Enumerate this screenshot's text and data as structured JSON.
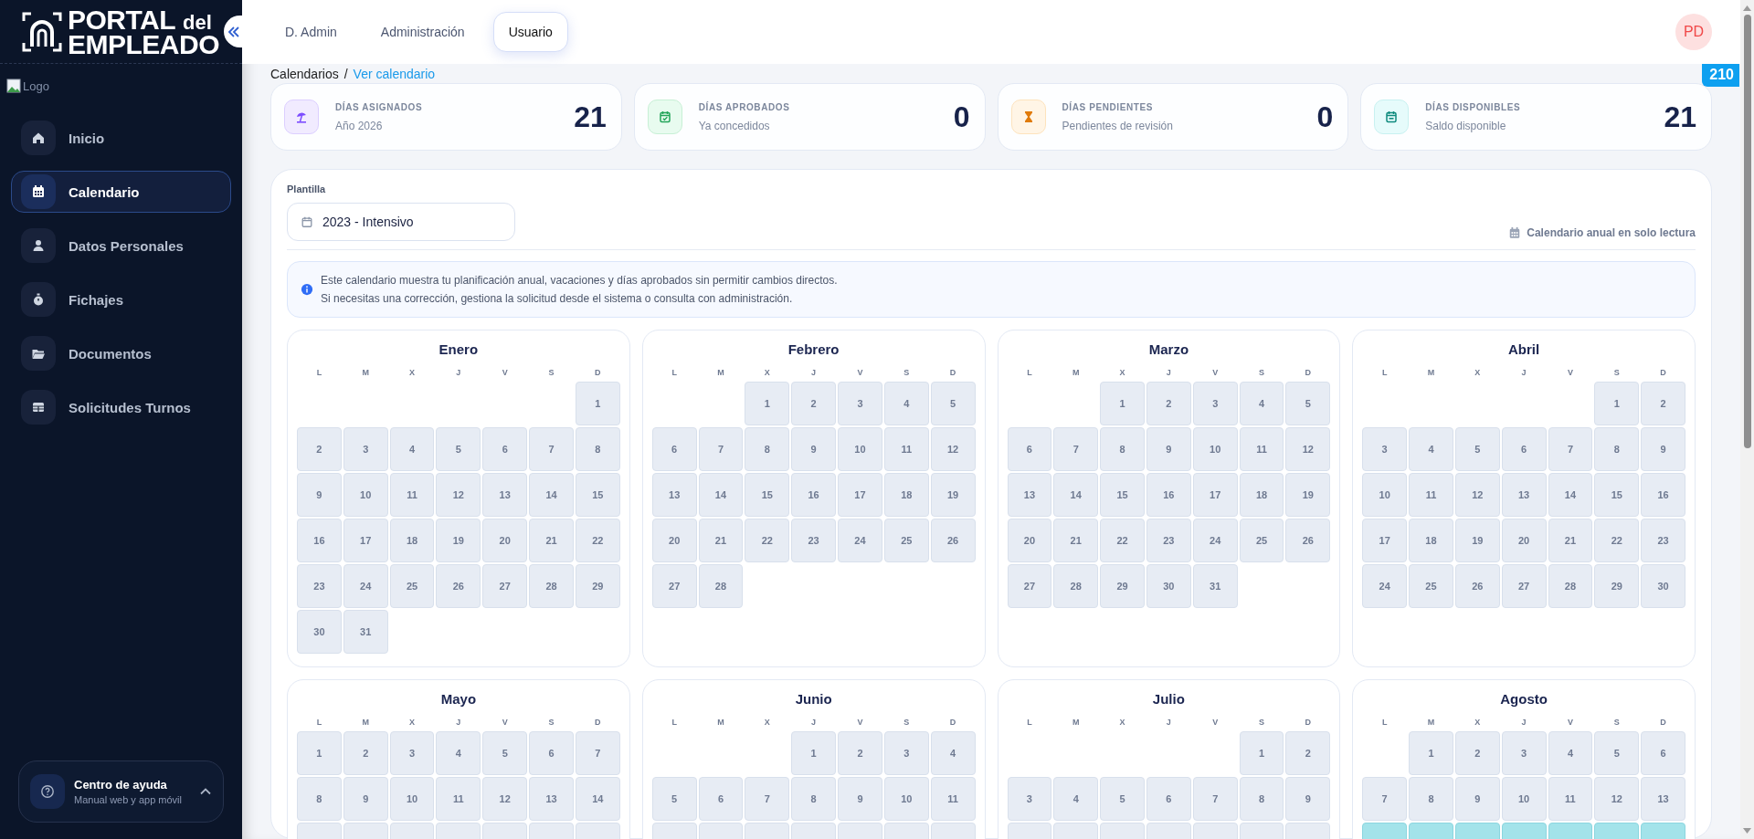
{
  "sidebar": {
    "logo": {
      "line1": "PORTAL",
      "line1_small": "del",
      "line2": "EMPLEADO"
    },
    "broken_image": {
      "alt": "Logo"
    },
    "items": [
      {
        "label": "Inicio",
        "kind": "home",
        "selected": false
      },
      {
        "label": "Calendario",
        "kind": "calendar",
        "selected": true
      },
      {
        "label": "Datos Personales",
        "kind": "user",
        "selected": false
      },
      {
        "label": "Fichajes",
        "kind": "stopwatch",
        "selected": false
      },
      {
        "label": "Documentos",
        "kind": "folder",
        "selected": false
      },
      {
        "label": "Solicitudes Turnos",
        "kind": "table",
        "selected": false
      }
    ],
    "help": {
      "title": "Centro de ayuda",
      "subtitle": "Manual web y app móvil"
    }
  },
  "topbar": {
    "tabs": [
      {
        "label": "D. Admin",
        "selected": false
      },
      {
        "label": "Administración",
        "selected": false
      },
      {
        "label": "Usuario",
        "selected": true
      }
    ],
    "avatar": "PD"
  },
  "badge": "210",
  "breadcrumb": {
    "parent": "Calendarios",
    "separator": "/",
    "current": "Ver calendario"
  },
  "stats": [
    {
      "kind": "assigned",
      "title": "DÍAS ASIGNADOS",
      "subtitle": "Año 2026",
      "value": "21"
    },
    {
      "kind": "approved",
      "title": "DÍAS APROBADOS",
      "subtitle": "Ya concedidos",
      "value": "0"
    },
    {
      "kind": "pending",
      "title": "DÍAS PENDIENTES",
      "subtitle": "Pendientes de revisión",
      "value": "0"
    },
    {
      "kind": "available",
      "title": "DÍAS DISPONIBLES",
      "subtitle": "Saldo disponible",
      "value": "21"
    }
  ],
  "panel": {
    "template_label": "Plantilla",
    "template_value": "2023 - Intensivo",
    "readonly_note": "Calendario anual en solo lectura",
    "info": [
      "Este calendario muestra tu planificación anual, vacaciones y días aprobados sin permitir cambios directos.",
      "Si necesitas una corrección, gestiona la solicitud desde el sistema o consulta con administración."
    ]
  },
  "months": [
    {
      "name": "Enero",
      "weekdays": [
        "L",
        "M",
        "X",
        "J",
        "V",
        "S",
        "D"
      ],
      "lead": [
        {
          "kind": "blank"
        },
        {
          "kind": "blank"
        },
        {
          "kind": "blank"
        },
        {
          "kind": "blank"
        },
        {
          "kind": "blank"
        },
        {
          "kind": "blank"
        }
      ],
      "days": [
        "1",
        "2",
        "3",
        "4",
        "5",
        "6",
        "7",
        "8",
        "9",
        "10",
        "11",
        "12",
        "13",
        "14",
        "15",
        "16",
        "17",
        "18",
        "19",
        "20",
        "21",
        "22",
        "23",
        "24",
        "25",
        "26",
        "27",
        "28",
        "29",
        "30",
        "31"
      ]
    },
    {
      "name": "Febrero",
      "weekdays": [
        "L",
        "M",
        "X",
        "J",
        "V",
        "S",
        "D"
      ],
      "lead": [
        {
          "kind": "blank"
        },
        {
          "kind": "blank"
        }
      ],
      "days": [
        "1",
        "2",
        "3",
        "4",
        "5",
        "6",
        "7",
        "8",
        "9",
        "10",
        "11",
        "12",
        "13",
        "14",
        "15",
        "16",
        "17",
        "18",
        "19",
        "20",
        "21",
        "22",
        "23",
        "24",
        "25",
        "26",
        "27",
        "28"
      ]
    },
    {
      "name": "Marzo",
      "weekdays": [
        "L",
        "M",
        "X",
        "J",
        "V",
        "S",
        "D"
      ],
      "lead": [
        {
          "kind": "blank"
        },
        {
          "kind": "blank"
        }
      ],
      "days": [
        "1",
        "2",
        "3",
        "4",
        "5",
        "6",
        "7",
        "8",
        "9",
        "10",
        "11",
        "12",
        "13",
        "14",
        "15",
        "16",
        "17",
        "18",
        "19",
        "20",
        "21",
        "22",
        "23",
        "24",
        "25",
        "26",
        "27",
        "28",
        "29",
        "30",
        "31"
      ]
    },
    {
      "name": "Abril",
      "weekdays": [
        "L",
        "M",
        "X",
        "J",
        "V",
        "S",
        "D"
      ],
      "lead": [
        {
          "kind": "blank"
        },
        {
          "kind": "blank"
        },
        {
          "kind": "blank"
        },
        {
          "kind": "blank"
        },
        {
          "kind": "blank"
        }
      ],
      "days": [
        "1",
        "2",
        "3",
        "4",
        "5",
        "6",
        "7",
        "8",
        "9",
        "10",
        "11",
        "12",
        "13",
        "14",
        "15",
        "16",
        "17",
        "18",
        "19",
        "20",
        "21",
        "22",
        "23",
        "24",
        "25",
        "26",
        "27",
        "28",
        "29",
        "30"
      ]
    },
    {
      "name": "Mayo",
      "weekdays": [
        "L",
        "M",
        "X",
        "J",
        "V",
        "S",
        "D"
      ],
      "days": [
        "1",
        "2",
        "3",
        "4",
        "5",
        "6",
        "7",
        "8",
        "9",
        "10",
        "11",
        "12",
        "13",
        "14"
      ],
      "next_row": {
        "kind": "plain"
      }
    },
    {
      "name": "Junio",
      "weekdays": [
        "L",
        "M",
        "X",
        "J",
        "V",
        "S",
        "D"
      ],
      "lead": [
        {
          "kind": "blank"
        },
        {
          "kind": "blank"
        },
        {
          "kind": "blank"
        }
      ],
      "days": [
        "1",
        "2",
        "3",
        "4",
        "5",
        "6",
        "7",
        "8",
        "9",
        "10",
        "11"
      ],
      "next_row": {
        "kind": "plain"
      }
    },
    {
      "name": "Julio",
      "weekdays": [
        "L",
        "M",
        "X",
        "J",
        "V",
        "S",
        "D"
      ],
      "lead": [
        {
          "kind": "blank"
        },
        {
          "kind": "blank"
        },
        {
          "kind": "blank"
        },
        {
          "kind": "blank"
        },
        {
          "kind": "blank"
        }
      ],
      "days": [
        "1",
        "2",
        "3",
        "4",
        "5",
        "6",
        "7",
        "8",
        "9"
      ],
      "next_row": {
        "kind": "plain"
      }
    },
    {
      "name": "Agosto",
      "weekdays": [
        "L",
        "M",
        "X",
        "J",
        "V",
        "S",
        "D"
      ],
      "lead": [
        {
          "kind": "blank"
        }
      ],
      "days": [
        "1",
        "2",
        "3",
        "4",
        "5",
        "6",
        "7",
        "8",
        "9",
        "10",
        "11",
        "12",
        "13"
      ],
      "next_row": {
        "kind": "vacation"
      }
    }
  ]
}
